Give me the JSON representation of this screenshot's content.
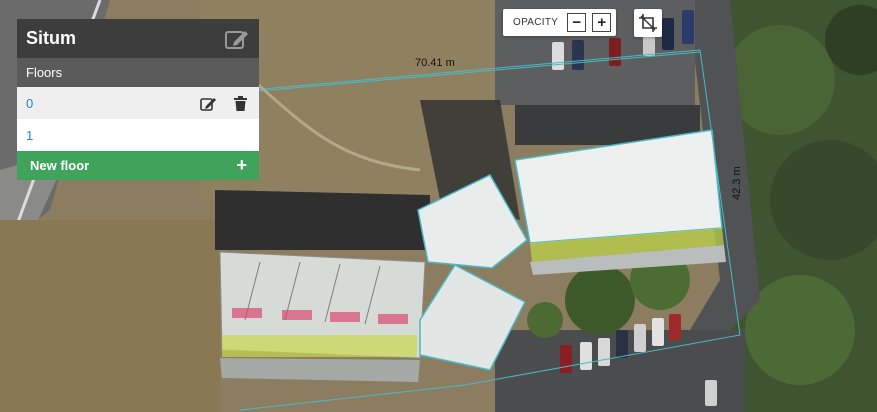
{
  "panel": {
    "title": "Situm",
    "section_label": "Floors",
    "floors": [
      {
        "label": "0",
        "selected": true
      },
      {
        "label": "1",
        "selected": false
      }
    ],
    "new_floor_label": "New floor",
    "new_floor_icon": "+"
  },
  "opacity": {
    "label": "OPACITY",
    "decrease": "−",
    "increase": "+"
  },
  "map": {
    "measure_top": "70.41 m",
    "measure_right": "42.3 m",
    "accent_color": "#4ab9c6",
    "panel_accent": "#3fa35b"
  },
  "icons": {
    "edit": "pencil-square-icon",
    "trash": "trash-icon",
    "crop": "crop-icon"
  }
}
